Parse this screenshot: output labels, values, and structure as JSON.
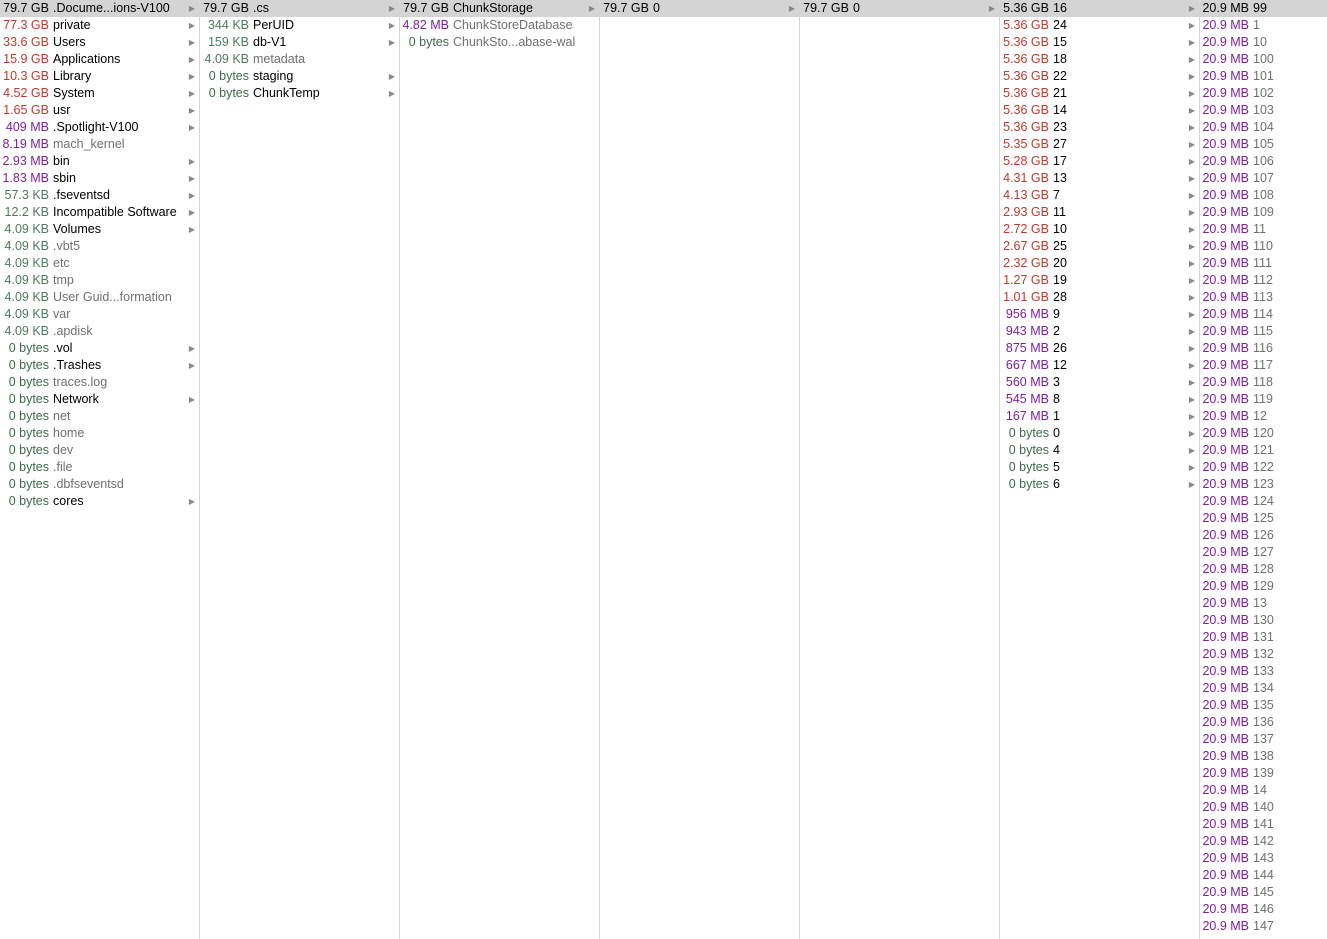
{
  "columns": [
    {
      "rows": [
        {
          "size": "79.7 GB",
          "name": ".Docume...ions-V100",
          "arrow": true,
          "sel": true
        },
        {
          "size": "77.3 GB",
          "name": "private",
          "arrow": true
        },
        {
          "size": "33.6 GB",
          "name": "Users",
          "arrow": true
        },
        {
          "size": "15.9 GB",
          "name": "Applications",
          "arrow": true
        },
        {
          "size": "10.3 GB",
          "name": "Library",
          "arrow": true
        },
        {
          "size": "4.52 GB",
          "name": "System",
          "arrow": true
        },
        {
          "size": "1.65 GB",
          "name": "usr",
          "arrow": true
        },
        {
          "size": "409 MB",
          "name": ".Spotlight-V100",
          "arrow": true
        },
        {
          "size": "8.19 MB",
          "name": "mach_kernel",
          "arrow": false,
          "dim": true
        },
        {
          "size": "2.93 MB",
          "name": "bin",
          "arrow": true
        },
        {
          "size": "1.83 MB",
          "name": "sbin",
          "arrow": true
        },
        {
          "size": "57.3 KB",
          "name": ".fseventsd",
          "arrow": true
        },
        {
          "size": "12.2 KB",
          "name": "Incompatible Software",
          "arrow": true
        },
        {
          "size": "4.09 KB",
          "name": "Volumes",
          "arrow": true
        },
        {
          "size": "4.09 KB",
          "name": ".vbt5",
          "arrow": false,
          "dim": true
        },
        {
          "size": "4.09 KB",
          "name": "etc",
          "arrow": false,
          "dim": true
        },
        {
          "size": "4.09 KB",
          "name": "tmp",
          "arrow": false,
          "dim": true
        },
        {
          "size": "4.09 KB",
          "name": "User Guid...formation",
          "arrow": false,
          "dim": true
        },
        {
          "size": "4.09 KB",
          "name": "var",
          "arrow": false,
          "dim": true
        },
        {
          "size": "4.09 KB",
          "name": ".apdisk",
          "arrow": false,
          "dim": true
        },
        {
          "size": "0 bytes",
          "name": ".vol",
          "arrow": true
        },
        {
          "size": "0 bytes",
          "name": ".Trashes",
          "arrow": true
        },
        {
          "size": "0 bytes",
          "name": "traces.log",
          "arrow": false,
          "dim": true
        },
        {
          "size": "0 bytes",
          "name": "Network",
          "arrow": true
        },
        {
          "size": "0 bytes",
          "name": "net",
          "arrow": false,
          "dim": true
        },
        {
          "size": "0 bytes",
          "name": "home",
          "arrow": false,
          "dim": true
        },
        {
          "size": "0 bytes",
          "name": "dev",
          "arrow": false,
          "dim": true
        },
        {
          "size": "0 bytes",
          "name": ".file",
          "arrow": false,
          "dim": true
        },
        {
          "size": "0 bytes",
          "name": ".dbfseventsd",
          "arrow": false,
          "dim": true
        },
        {
          "size": "0 bytes",
          "name": "cores",
          "arrow": true
        }
      ]
    },
    {
      "rows": [
        {
          "size": "79.7 GB",
          "name": ".cs",
          "arrow": true,
          "sel": true
        },
        {
          "size": "344 KB",
          "name": "PerUID",
          "arrow": true
        },
        {
          "size": "159 KB",
          "name": "db-V1",
          "arrow": true
        },
        {
          "size": "4.09 KB",
          "name": "metadata",
          "arrow": false,
          "dim": true
        },
        {
          "size": "0 bytes",
          "name": "staging",
          "arrow": true
        },
        {
          "size": "0 bytes",
          "name": "ChunkTemp",
          "arrow": true
        }
      ]
    },
    {
      "rows": [
        {
          "size": "79.7 GB",
          "name": "ChunkStorage",
          "arrow": true,
          "sel": true
        },
        {
          "size": "4.82 MB",
          "name": "ChunkStoreDatabase",
          "arrow": false,
          "dim": true
        },
        {
          "size": "0 bytes",
          "name": "ChunkSto...abase-wal",
          "arrow": false,
          "dim": true
        }
      ]
    },
    {
      "rows": [
        {
          "size": "79.7 GB",
          "name": "0",
          "arrow": true,
          "sel": true
        }
      ]
    },
    {
      "rows": [
        {
          "size": "79.7 GB",
          "name": "0",
          "arrow": true,
          "sel": true
        }
      ]
    },
    {
      "rows": [
        {
          "size": "5.36 GB",
          "name": "16",
          "arrow": true,
          "sel": true
        },
        {
          "size": "5.36 GB",
          "name": "24",
          "arrow": true
        },
        {
          "size": "5.36 GB",
          "name": "15",
          "arrow": true
        },
        {
          "size": "5.36 GB",
          "name": "18",
          "arrow": true
        },
        {
          "size": "5.36 GB",
          "name": "22",
          "arrow": true
        },
        {
          "size": "5.36 GB",
          "name": "21",
          "arrow": true
        },
        {
          "size": "5.36 GB",
          "name": "14",
          "arrow": true
        },
        {
          "size": "5.36 GB",
          "name": "23",
          "arrow": true
        },
        {
          "size": "5.35 GB",
          "name": "27",
          "arrow": true
        },
        {
          "size": "5.28 GB",
          "name": "17",
          "arrow": true
        },
        {
          "size": "4.31 GB",
          "name": "13",
          "arrow": true
        },
        {
          "size": "4.13 GB",
          "name": "7",
          "arrow": true
        },
        {
          "size": "2.93 GB",
          "name": "11",
          "arrow": true
        },
        {
          "size": "2.72 GB",
          "name": "10",
          "arrow": true
        },
        {
          "size": "2.67 GB",
          "name": "25",
          "arrow": true
        },
        {
          "size": "2.32 GB",
          "name": "20",
          "arrow": true
        },
        {
          "size": "1.27 GB",
          "name": "19",
          "arrow": true
        },
        {
          "size": "1.01 GB",
          "name": "28",
          "arrow": true
        },
        {
          "size": "956 MB",
          "name": "9",
          "arrow": true
        },
        {
          "size": "943 MB",
          "name": "2",
          "arrow": true
        },
        {
          "size": "875 MB",
          "name": "26",
          "arrow": true
        },
        {
          "size": "667 MB",
          "name": "12",
          "arrow": true
        },
        {
          "size": "560 MB",
          "name": "3",
          "arrow": true
        },
        {
          "size": "545 MB",
          "name": "8",
          "arrow": true
        },
        {
          "size": "167 MB",
          "name": "1",
          "arrow": true
        },
        {
          "size": "0 bytes",
          "name": "0",
          "arrow": true
        },
        {
          "size": "0 bytes",
          "name": "4",
          "arrow": true
        },
        {
          "size": "0 bytes",
          "name": "5",
          "arrow": true
        },
        {
          "size": "0 bytes",
          "name": "6",
          "arrow": true
        }
      ]
    },
    {
      "rows": [
        {
          "size": "20.9 MB",
          "name": "99",
          "arrow": false,
          "sel": true
        },
        {
          "size": "20.9 MB",
          "name": "1",
          "arrow": false,
          "dim": true
        },
        {
          "size": "20.9 MB",
          "name": "10",
          "arrow": false,
          "dim": true
        },
        {
          "size": "20.9 MB",
          "name": "100",
          "arrow": false,
          "dim": true
        },
        {
          "size": "20.9 MB",
          "name": "101",
          "arrow": false,
          "dim": true
        },
        {
          "size": "20.9 MB",
          "name": "102",
          "arrow": false,
          "dim": true
        },
        {
          "size": "20.9 MB",
          "name": "103",
          "arrow": false,
          "dim": true
        },
        {
          "size": "20.9 MB",
          "name": "104",
          "arrow": false,
          "dim": true
        },
        {
          "size": "20.9 MB",
          "name": "105",
          "arrow": false,
          "dim": true
        },
        {
          "size": "20.9 MB",
          "name": "106",
          "arrow": false,
          "dim": true
        },
        {
          "size": "20.9 MB",
          "name": "107",
          "arrow": false,
          "dim": true
        },
        {
          "size": "20.9 MB",
          "name": "108",
          "arrow": false,
          "dim": true
        },
        {
          "size": "20.9 MB",
          "name": "109",
          "arrow": false,
          "dim": true
        },
        {
          "size": "20.9 MB",
          "name": "11",
          "arrow": false,
          "dim": true
        },
        {
          "size": "20.9 MB",
          "name": "110",
          "arrow": false,
          "dim": true
        },
        {
          "size": "20.9 MB",
          "name": "111",
          "arrow": false,
          "dim": true
        },
        {
          "size": "20.9 MB",
          "name": "112",
          "arrow": false,
          "dim": true
        },
        {
          "size": "20.9 MB",
          "name": "113",
          "arrow": false,
          "dim": true
        },
        {
          "size": "20.9 MB",
          "name": "114",
          "arrow": false,
          "dim": true
        },
        {
          "size": "20.9 MB",
          "name": "115",
          "arrow": false,
          "dim": true
        },
        {
          "size": "20.9 MB",
          "name": "116",
          "arrow": false,
          "dim": true
        },
        {
          "size": "20.9 MB",
          "name": "117",
          "arrow": false,
          "dim": true
        },
        {
          "size": "20.9 MB",
          "name": "118",
          "arrow": false,
          "dim": true
        },
        {
          "size": "20.9 MB",
          "name": "119",
          "arrow": false,
          "dim": true
        },
        {
          "size": "20.9 MB",
          "name": "12",
          "arrow": false,
          "dim": true
        },
        {
          "size": "20.9 MB",
          "name": "120",
          "arrow": false,
          "dim": true
        },
        {
          "size": "20.9 MB",
          "name": "121",
          "arrow": false,
          "dim": true
        },
        {
          "size": "20.9 MB",
          "name": "122",
          "arrow": false,
          "dim": true
        },
        {
          "size": "20.9 MB",
          "name": "123",
          "arrow": false,
          "dim": true
        },
        {
          "size": "20.9 MB",
          "name": "124",
          "arrow": false,
          "dim": true
        },
        {
          "size": "20.9 MB",
          "name": "125",
          "arrow": false,
          "dim": true
        },
        {
          "size": "20.9 MB",
          "name": "126",
          "arrow": false,
          "dim": true
        },
        {
          "size": "20.9 MB",
          "name": "127",
          "arrow": false,
          "dim": true
        },
        {
          "size": "20.9 MB",
          "name": "128",
          "arrow": false,
          "dim": true
        },
        {
          "size": "20.9 MB",
          "name": "129",
          "arrow": false,
          "dim": true
        },
        {
          "size": "20.9 MB",
          "name": "13",
          "arrow": false,
          "dim": true
        },
        {
          "size": "20.9 MB",
          "name": "130",
          "arrow": false,
          "dim": true
        },
        {
          "size": "20.9 MB",
          "name": "131",
          "arrow": false,
          "dim": true
        },
        {
          "size": "20.9 MB",
          "name": "132",
          "arrow": false,
          "dim": true
        },
        {
          "size": "20.9 MB",
          "name": "133",
          "arrow": false,
          "dim": true
        },
        {
          "size": "20.9 MB",
          "name": "134",
          "arrow": false,
          "dim": true
        },
        {
          "size": "20.9 MB",
          "name": "135",
          "arrow": false,
          "dim": true
        },
        {
          "size": "20.9 MB",
          "name": "136",
          "arrow": false,
          "dim": true
        },
        {
          "size": "20.9 MB",
          "name": "137",
          "arrow": false,
          "dim": true
        },
        {
          "size": "20.9 MB",
          "name": "138",
          "arrow": false,
          "dim": true
        },
        {
          "size": "20.9 MB",
          "name": "139",
          "arrow": false,
          "dim": true
        },
        {
          "size": "20.9 MB",
          "name": "14",
          "arrow": false,
          "dim": true
        },
        {
          "size": "20.9 MB",
          "name": "140",
          "arrow": false,
          "dim": true
        },
        {
          "size": "20.9 MB",
          "name": "141",
          "arrow": false,
          "dim": true
        },
        {
          "size": "20.9 MB",
          "name": "142",
          "arrow": false,
          "dim": true
        },
        {
          "size": "20.9 MB",
          "name": "143",
          "arrow": false,
          "dim": true
        },
        {
          "size": "20.9 MB",
          "name": "144",
          "arrow": false,
          "dim": true
        },
        {
          "size": "20.9 MB",
          "name": "145",
          "arrow": false,
          "dim": true
        },
        {
          "size": "20.9 MB",
          "name": "146",
          "arrow": false,
          "dim": true
        },
        {
          "size": "20.9 MB",
          "name": "147",
          "arrow": false,
          "dim": true
        }
      ]
    }
  ],
  "colors": {
    "selection": "#d4d4d4",
    "divider": "#d6d6d6",
    "gb": "#c0392b",
    "mb": "#7d1fa0",
    "kb": "#4f7a5f",
    "bytes": "#3c6b4b"
  },
  "icons": {
    "disclosure": "disclosure-triangle-icon"
  }
}
